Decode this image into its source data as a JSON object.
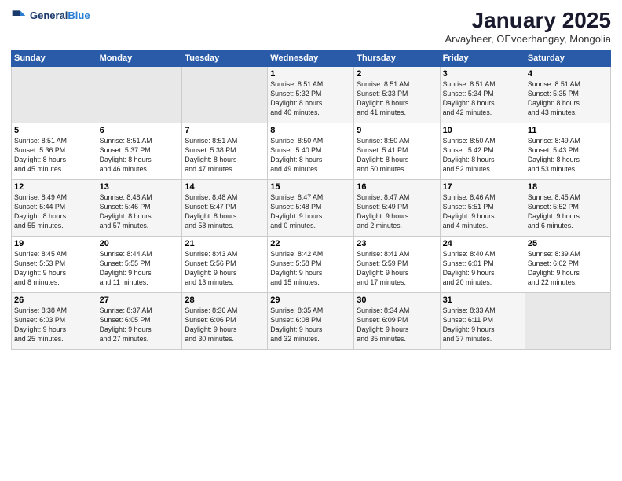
{
  "header": {
    "logo_line1": "General",
    "logo_line2": "Blue",
    "month": "January 2025",
    "location": "Arvayheer, OEvoerhangay, Mongolia"
  },
  "weekdays": [
    "Sunday",
    "Monday",
    "Tuesday",
    "Wednesday",
    "Thursday",
    "Friday",
    "Saturday"
  ],
  "weeks": [
    [
      {
        "day": "",
        "info": ""
      },
      {
        "day": "",
        "info": ""
      },
      {
        "day": "",
        "info": ""
      },
      {
        "day": "1",
        "info": "Sunrise: 8:51 AM\nSunset: 5:32 PM\nDaylight: 8 hours\nand 40 minutes."
      },
      {
        "day": "2",
        "info": "Sunrise: 8:51 AM\nSunset: 5:33 PM\nDaylight: 8 hours\nand 41 minutes."
      },
      {
        "day": "3",
        "info": "Sunrise: 8:51 AM\nSunset: 5:34 PM\nDaylight: 8 hours\nand 42 minutes."
      },
      {
        "day": "4",
        "info": "Sunrise: 8:51 AM\nSunset: 5:35 PM\nDaylight: 8 hours\nand 43 minutes."
      }
    ],
    [
      {
        "day": "5",
        "info": "Sunrise: 8:51 AM\nSunset: 5:36 PM\nDaylight: 8 hours\nand 45 minutes."
      },
      {
        "day": "6",
        "info": "Sunrise: 8:51 AM\nSunset: 5:37 PM\nDaylight: 8 hours\nand 46 minutes."
      },
      {
        "day": "7",
        "info": "Sunrise: 8:51 AM\nSunset: 5:38 PM\nDaylight: 8 hours\nand 47 minutes."
      },
      {
        "day": "8",
        "info": "Sunrise: 8:50 AM\nSunset: 5:40 PM\nDaylight: 8 hours\nand 49 minutes."
      },
      {
        "day": "9",
        "info": "Sunrise: 8:50 AM\nSunset: 5:41 PM\nDaylight: 8 hours\nand 50 minutes."
      },
      {
        "day": "10",
        "info": "Sunrise: 8:50 AM\nSunset: 5:42 PM\nDaylight: 8 hours\nand 52 minutes."
      },
      {
        "day": "11",
        "info": "Sunrise: 8:49 AM\nSunset: 5:43 PM\nDaylight: 8 hours\nand 53 minutes."
      }
    ],
    [
      {
        "day": "12",
        "info": "Sunrise: 8:49 AM\nSunset: 5:44 PM\nDaylight: 8 hours\nand 55 minutes."
      },
      {
        "day": "13",
        "info": "Sunrise: 8:48 AM\nSunset: 5:46 PM\nDaylight: 8 hours\nand 57 minutes."
      },
      {
        "day": "14",
        "info": "Sunrise: 8:48 AM\nSunset: 5:47 PM\nDaylight: 8 hours\nand 58 minutes."
      },
      {
        "day": "15",
        "info": "Sunrise: 8:47 AM\nSunset: 5:48 PM\nDaylight: 9 hours\nand 0 minutes."
      },
      {
        "day": "16",
        "info": "Sunrise: 8:47 AM\nSunset: 5:49 PM\nDaylight: 9 hours\nand 2 minutes."
      },
      {
        "day": "17",
        "info": "Sunrise: 8:46 AM\nSunset: 5:51 PM\nDaylight: 9 hours\nand 4 minutes."
      },
      {
        "day": "18",
        "info": "Sunrise: 8:45 AM\nSunset: 5:52 PM\nDaylight: 9 hours\nand 6 minutes."
      }
    ],
    [
      {
        "day": "19",
        "info": "Sunrise: 8:45 AM\nSunset: 5:53 PM\nDaylight: 9 hours\nand 8 minutes."
      },
      {
        "day": "20",
        "info": "Sunrise: 8:44 AM\nSunset: 5:55 PM\nDaylight: 9 hours\nand 11 minutes."
      },
      {
        "day": "21",
        "info": "Sunrise: 8:43 AM\nSunset: 5:56 PM\nDaylight: 9 hours\nand 13 minutes."
      },
      {
        "day": "22",
        "info": "Sunrise: 8:42 AM\nSunset: 5:58 PM\nDaylight: 9 hours\nand 15 minutes."
      },
      {
        "day": "23",
        "info": "Sunrise: 8:41 AM\nSunset: 5:59 PM\nDaylight: 9 hours\nand 17 minutes."
      },
      {
        "day": "24",
        "info": "Sunrise: 8:40 AM\nSunset: 6:01 PM\nDaylight: 9 hours\nand 20 minutes."
      },
      {
        "day": "25",
        "info": "Sunrise: 8:39 AM\nSunset: 6:02 PM\nDaylight: 9 hours\nand 22 minutes."
      }
    ],
    [
      {
        "day": "26",
        "info": "Sunrise: 8:38 AM\nSunset: 6:03 PM\nDaylight: 9 hours\nand 25 minutes."
      },
      {
        "day": "27",
        "info": "Sunrise: 8:37 AM\nSunset: 6:05 PM\nDaylight: 9 hours\nand 27 minutes."
      },
      {
        "day": "28",
        "info": "Sunrise: 8:36 AM\nSunset: 6:06 PM\nDaylight: 9 hours\nand 30 minutes."
      },
      {
        "day": "29",
        "info": "Sunrise: 8:35 AM\nSunset: 6:08 PM\nDaylight: 9 hours\nand 32 minutes."
      },
      {
        "day": "30",
        "info": "Sunrise: 8:34 AM\nSunset: 6:09 PM\nDaylight: 9 hours\nand 35 minutes."
      },
      {
        "day": "31",
        "info": "Sunrise: 8:33 AM\nSunset: 6:11 PM\nDaylight: 9 hours\nand 37 minutes."
      },
      {
        "day": "",
        "info": ""
      }
    ]
  ]
}
